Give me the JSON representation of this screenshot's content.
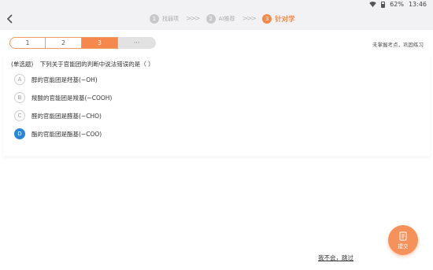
{
  "status": {
    "battery_percent": "62%",
    "time": "13:46"
  },
  "steps": [
    {
      "num": "1",
      "label": "找弱项"
    },
    {
      "num": "2",
      "label": "AI推荐"
    },
    {
      "num": "3",
      "label": "针对学"
    }
  ],
  "progress": {
    "segments": [
      "1",
      "2",
      "3",
      "···"
    ],
    "current_index": 2,
    "hint": "未掌握考点，巩固练习"
  },
  "question": {
    "type": "(单选题)",
    "text": "下列关于官能团的判断中说法错误的是（    ）",
    "options": [
      {
        "letter": "A",
        "text": "醇的官能团是羟基(−OH)"
      },
      {
        "letter": "B",
        "text": "羧酸的官能团是羧基(−COOH)"
      },
      {
        "letter": "C",
        "text": "醛的官能团是醛基(−CHO)"
      },
      {
        "letter": "D",
        "text": "酯的官能团是酯基(−COO)"
      }
    ],
    "selected": "D"
  },
  "actions": {
    "submit": "提交",
    "skip": "我不会，跳过"
  },
  "colors": {
    "accent": "#f5894d",
    "selected": "#2a86d8"
  }
}
